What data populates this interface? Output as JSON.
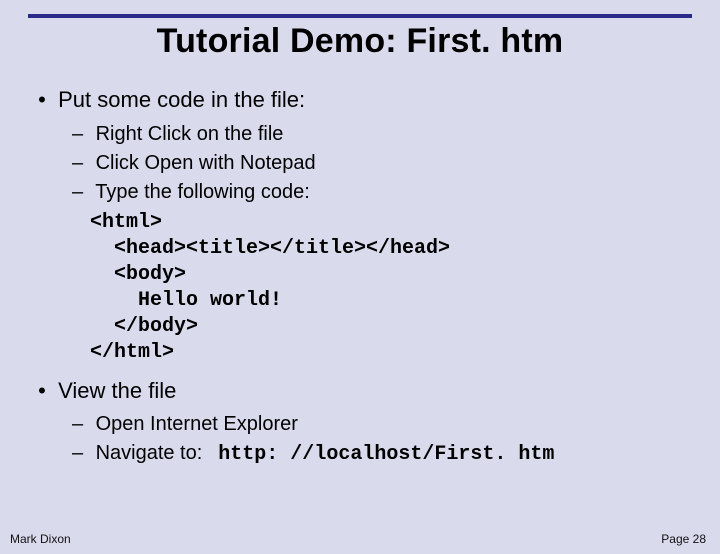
{
  "title": "Tutorial Demo: First. htm",
  "bullets": [
    {
      "text": "Put some code in the file:",
      "sub": [
        "Right Click on the file",
        "Click Open with Notepad",
        "Type the following code:"
      ]
    },
    {
      "text": "View the file",
      "sub": [
        "Open Internet Explorer",
        "Navigate to:"
      ]
    }
  ],
  "code_lines": [
    "<html>",
    "  <head><title></title></head>",
    "  <body>",
    "    Hello world!",
    "  </body>",
    "</html>"
  ],
  "navigate_url": "http: //localhost/First. htm",
  "footer": {
    "author": "Mark Dixon",
    "page": "Page 28"
  }
}
